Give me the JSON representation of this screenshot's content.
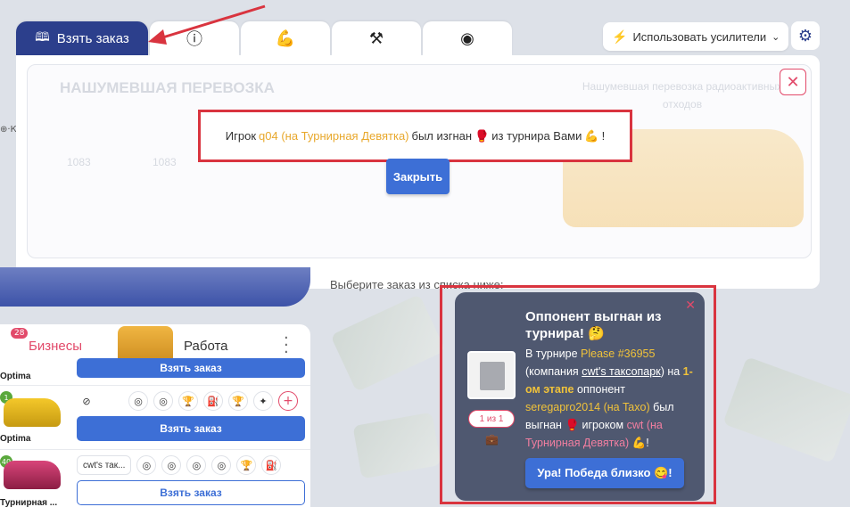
{
  "tabs": {
    "active_label": "Взять заказ",
    "icons": [
      "info-icon",
      "muscle-icon",
      "tools-icon",
      "speedometer-icon"
    ]
  },
  "toolbar": {
    "boost_label": "Использовать усилители"
  },
  "background_panel": {
    "title": "НАШУМЕВШАЯ ПЕРЕВОЗКА",
    "right_title": "Нашумевшая перевозка радиоактивных отходов",
    "stat_a": "1083",
    "stat_b": "1083"
  },
  "notice": {
    "prefix": "Игрок",
    "player": "q04 (на Турнирная Девятка)",
    "middle": "был изгнан",
    "suffix": "из турнира Вами",
    "end": "!"
  },
  "close_button": "Закрыть",
  "pick_hint": "Выберите заказ из списка ниже:",
  "list": {
    "biz_tab": "Бизнесы",
    "biz_badge": "28",
    "work_tab": "Работа",
    "rows": [
      {
        "name": "Optima",
        "button": "Взять заказ"
      },
      {
        "name": "Optima",
        "level": "1",
        "button": "Взять заказ"
      },
      {
        "name": "Турнирная ...",
        "level": "40",
        "company_chip": "cwt's так...",
        "button": "Взять заказ"
      }
    ]
  },
  "popup": {
    "title": "Оппонент выгнан из турнира!",
    "t1": "В турнире",
    "tournament": "Please #36955",
    "t2": "(компания",
    "company": "cwt's таксопарк",
    "t3": ") на",
    "stage": "1-ом этапе",
    "t4": "оппонент",
    "opponent": "seregapro2014 (на Taxo)",
    "t5": "был выгнан",
    "t6": "игроком",
    "player": "cwt (на Турнирная Девятка)",
    "t7": "!",
    "counter": "1 из 1",
    "button": "Ура! Победа близко 😋!"
  }
}
